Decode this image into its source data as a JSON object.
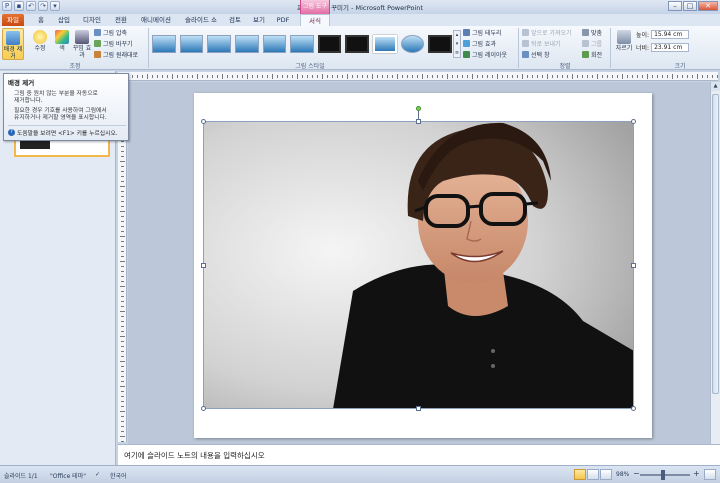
{
  "window": {
    "title": "프로필 사진 꾸미기 - Microsoft PowerPoint",
    "context_tab_group": "그림 도구"
  },
  "tabs": [
    "파일",
    "홈",
    "삽입",
    "디자인",
    "전환",
    "애니메이션",
    "슬라이드 쇼",
    "검토",
    "보기",
    "PDF",
    "서식"
  ],
  "ribbon": {
    "adjust": {
      "remove_bg": "배경 제거",
      "corrections": "수정",
      "color": "색",
      "artistic": "꾸밈 효과",
      "compress": "그림 압축",
      "change": "그림 바꾸기",
      "reset": "그림 원래대로",
      "group_label": "조정"
    },
    "styles_group_label": "그림 스타일",
    "picture_border": "그림 테두리",
    "picture_effects": "그림 효과",
    "picture_layout": "그림 레이아웃",
    "arrange": {
      "bring_forward": "앞으로 가져오기",
      "send_backward": "뒤로 보내기",
      "selection_pane": "선택 창",
      "align": "맞춤",
      "group": "그룹",
      "rotate": "회전",
      "group_label": "정렬"
    },
    "size": {
      "crop": "자르기",
      "height_label": "높이:",
      "height_value": "15.94 cm",
      "width_label": "너비:",
      "width_value": "23.91 cm",
      "group_label": "크기"
    }
  },
  "tooltip": {
    "title": "배경 제거",
    "line1": "그림 중 원치 않는 부분을 자동으로",
    "line2": "제거합니다.",
    "line3": "필요한 경우 기호를 사용하여 그림에서",
    "line4": "유지하거나 제거할 영역을 표시합니다.",
    "help": "도움말을 보려면 <F1> 키를 누르십시오."
  },
  "notes_placeholder": "여기에 슬라이드 노트의 내용을 입력하십시오",
  "status": {
    "slide": "슬라이드 1/1",
    "theme": "\"Office 테마\"",
    "language": "한국어",
    "zoom": "98%"
  },
  "colors": {
    "file_tab": "#d25a1c",
    "context_tab": "#e36ca3",
    "selected_button": "#f7cd52"
  }
}
